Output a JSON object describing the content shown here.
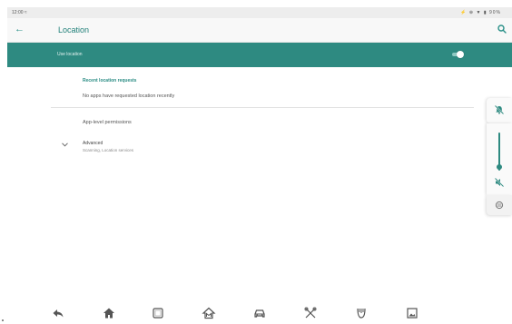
{
  "status_bar": {
    "time": "12:00 ≈",
    "indicators": "⚡ ⊕ ▼ ▮ 90%"
  },
  "app_bar": {
    "title": "Location",
    "back_icon": "arrow-left-icon",
    "search_icon": "search-icon"
  },
  "master_switch": {
    "label": "Use location",
    "enabled": true
  },
  "content": {
    "section_header": "Recent location requests",
    "no_requests_text": "No apps have requested location recently",
    "app_permissions_label": "App-level permissions",
    "advanced": {
      "title": "Advanced",
      "subtitle": "Scanning, Location services"
    }
  },
  "volume_panel": {
    "ringer_icon": "ringer-muted-icon",
    "media_icon": "media-muted-icon",
    "settings_icon": "settings-icon",
    "level": 0.9
  },
  "nav_bar": {
    "items": [
      "back-icon",
      "home-icon",
      "recents-icon",
      "dealer-home-icon",
      "car-icon",
      "tools-icon",
      "diagnostics-icon",
      "gallery-icon"
    ]
  },
  "colors": {
    "accent": "#2e8a81",
    "title": "#1f7f78"
  }
}
